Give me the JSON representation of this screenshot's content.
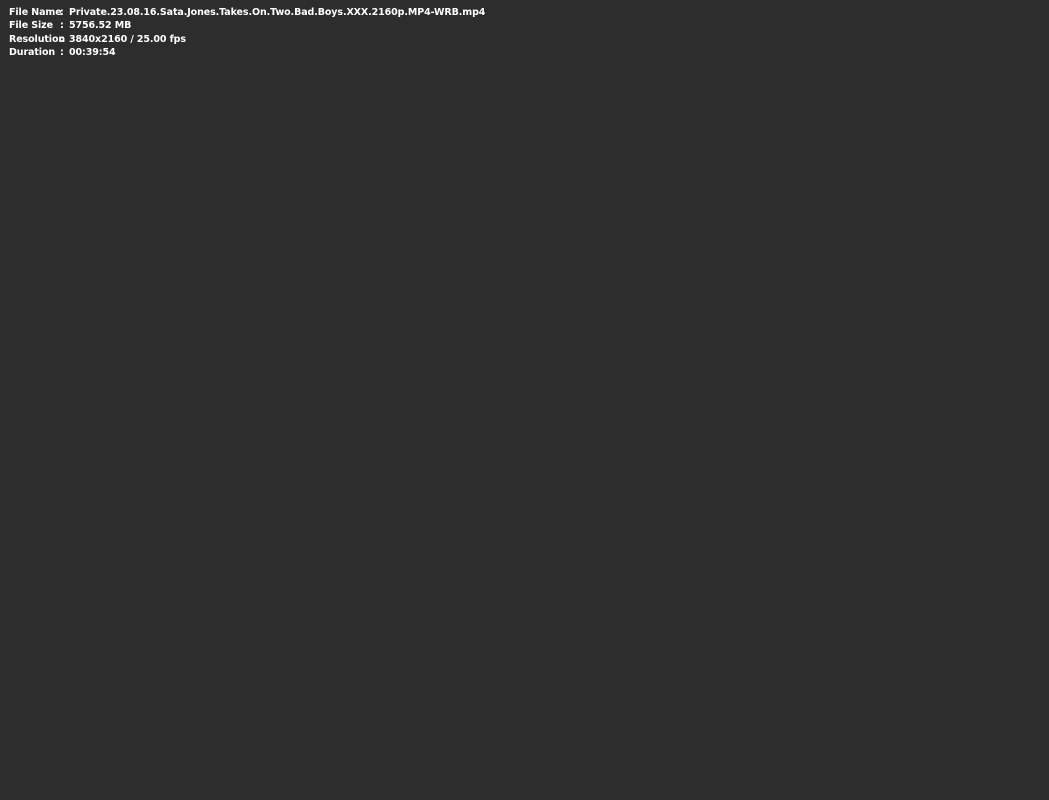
{
  "media_info": {
    "rows": [
      {
        "label": "File Name",
        "separator": ":",
        "value": "Private.23.08.16.Sata.Jones.Takes.On.Two.Bad.Boys.XXX.2160p.MP4-WRB.mp4"
      },
      {
        "label": "File Size",
        "separator": ":",
        "value": "5756.52 MB"
      },
      {
        "label": "Resolution",
        "separator": ":",
        "value": "3840x2160 / 25.00 fps"
      },
      {
        "label": "Duration",
        "separator": ":",
        "value": "00:39:54"
      }
    ]
  },
  "colors": {
    "background": "#2d2d2d",
    "text": "#ffffff"
  }
}
